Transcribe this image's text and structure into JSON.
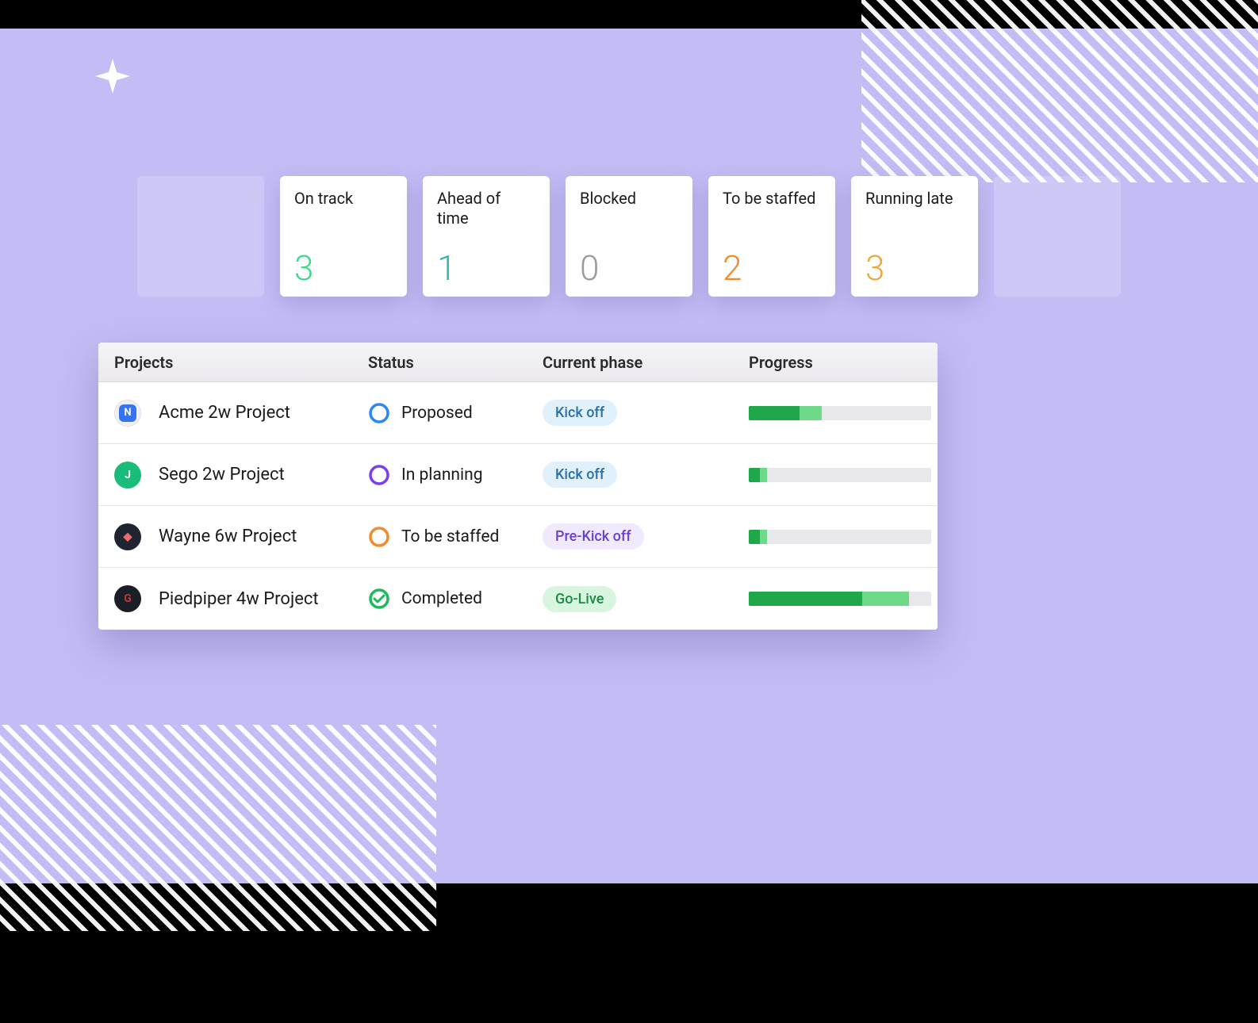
{
  "stats": [
    {
      "label": "On track",
      "value": "3",
      "color": "#3dd98a"
    },
    {
      "label": "Ahead of time",
      "value": "1",
      "color": "#2fb8b0"
    },
    {
      "label": "Blocked",
      "value": "0",
      "color": "#9a9a9a"
    },
    {
      "label": "To be staffed",
      "value": "2",
      "color": "#f28a2e"
    },
    {
      "label": "Running late",
      "value": "3",
      "color": "#f2a33c"
    }
  ],
  "columns": {
    "projects": "Projects",
    "status": "Status",
    "phase": "Current phase",
    "progress": "Progress"
  },
  "rows": [
    {
      "project": "Acme 2w Project",
      "logo": {
        "bg": "#f0f0f2",
        "inner_bg": "#3573f0",
        "letter": "N"
      },
      "status": {
        "label": "Proposed",
        "ring": "#2d87f3",
        "check": false
      },
      "phase": {
        "label": "Kick off",
        "bg": "#e1f1fb",
        "fg": "#2d6fa8"
      },
      "progress": {
        "dark": 28,
        "light": 40
      }
    },
    {
      "project": "Sego 2w Project",
      "logo": {
        "bg": "#1abc7a",
        "inner_bg": "#1abc7a",
        "letter": "J"
      },
      "status": {
        "label": "In planning",
        "ring": "#7a3ff0",
        "check": false
      },
      "phase": {
        "label": "Kick off",
        "bg": "#e1f1fb",
        "fg": "#2d6fa8"
      },
      "progress": {
        "dark": 6,
        "light": 10
      }
    },
    {
      "project": "Wayne 6w Project",
      "logo": {
        "bg": "#1e2430",
        "inner_bg": "#1e2430",
        "letter": "◆"
      },
      "status": {
        "label": "To be staffed",
        "ring": "#f28a2e",
        "check": false
      },
      "phase": {
        "label": "Pre-Kick off",
        "bg": "#f1eafe",
        "fg": "#6b3fd4"
      },
      "progress": {
        "dark": 6,
        "light": 10
      }
    },
    {
      "project": "Piedpiper 4w Project",
      "logo": {
        "bg": "#1a1e26",
        "inner_bg": "#1a1e26",
        "letter": "G"
      },
      "status": {
        "label": "Completed",
        "ring": "#1fb85c",
        "check": true
      },
      "phase": {
        "label": "Go-Live",
        "bg": "#d8f5df",
        "fg": "#1f8a44"
      },
      "progress": {
        "dark": 62,
        "light": 88
      }
    }
  ]
}
